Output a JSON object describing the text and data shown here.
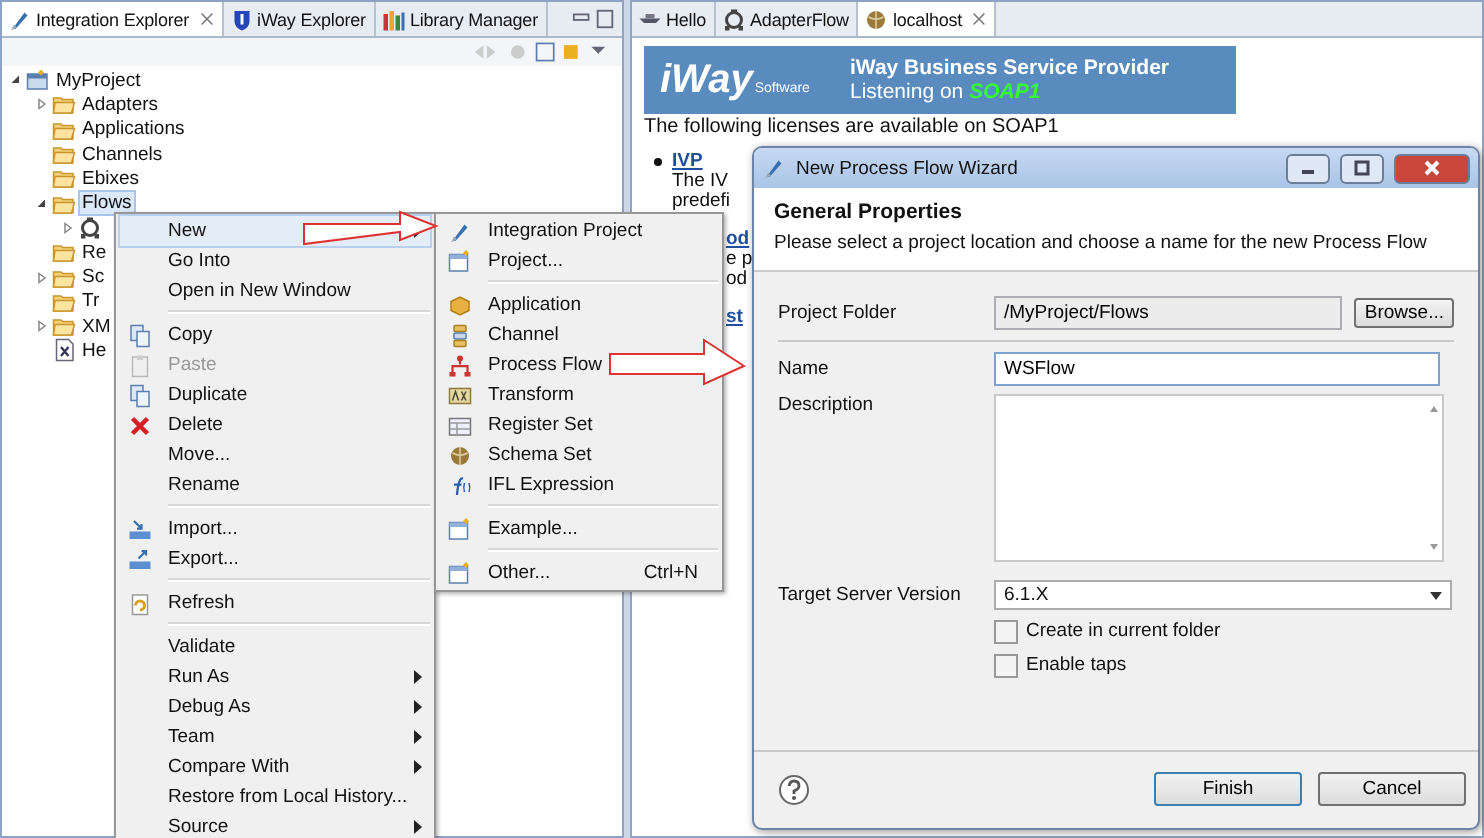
{
  "left_panel": {
    "tabs": [
      {
        "label": "Integration Explorer",
        "selected": true,
        "closable": true
      },
      {
        "label": "iWay Explorer",
        "selected": false,
        "closable": false
      },
      {
        "label": "Library Manager",
        "selected": false,
        "closable": false
      }
    ],
    "tree": [
      {
        "label": "MyProject",
        "kind": "project",
        "expanded": true,
        "selected": false,
        "children": [
          {
            "label": "Adapters",
            "kind": "folder",
            "expanded": false,
            "selected": false
          },
          {
            "label": "Applications",
            "kind": "folder",
            "selected": false
          },
          {
            "label": "Channels",
            "kind": "folder",
            "selected": false
          },
          {
            "label": "Ebixes",
            "kind": "folder",
            "selected": false
          },
          {
            "label": "Flows",
            "kind": "folder",
            "expanded": true,
            "selected": true,
            "children": [
              {
                "kind": "flow",
                "expanded": false
              }
            ]
          },
          {
            "label": "Re",
            "kind": "folder",
            "selected": false
          },
          {
            "label": "Sc",
            "kind": "folder",
            "expanded": false,
            "selected": false
          },
          {
            "label": "Tr",
            "kind": "folder",
            "selected": false
          },
          {
            "label": "XM",
            "kind": "folder",
            "expanded": false,
            "selected": false
          },
          {
            "label": "He",
            "kind": "file",
            "selected": false
          }
        ]
      }
    ]
  },
  "right_panel": {
    "tabs": [
      {
        "label": "Hello",
        "selected": false,
        "closable": false
      },
      {
        "label": "AdapterFlow",
        "selected": false,
        "closable": false
      },
      {
        "label": "localhost",
        "selected": true,
        "closable": true
      }
    ],
    "banner": {
      "logo_text": "iWay",
      "logo_subtext": "Software",
      "title": "iWay Business Service Provider",
      "listening_label": "Listening on",
      "listening_port": "SOAP1"
    },
    "intro": "The following licenses are available on SOAP1",
    "entries": [
      {
        "kind": "link",
        "text": "IVP",
        "bullet": true
      },
      {
        "kind": "text",
        "text": "The IV"
      },
      {
        "kind": "text",
        "text": "predefi"
      },
      {
        "kind": "fragment_link",
        "text": "od"
      },
      {
        "kind": "fragment",
        "text": "e p"
      },
      {
        "kind": "fragment",
        "text": "od"
      },
      {
        "kind": "fragment_link",
        "text": "st"
      }
    ]
  },
  "context_menu": {
    "groups": [
      [
        {
          "label": "New",
          "submenu": true,
          "selected": true,
          "disabled": false
        },
        {
          "label": "Go Into",
          "submenu": false,
          "selected": false,
          "disabled": false
        },
        {
          "label": "Open in New Window",
          "submenu": false,
          "selected": false,
          "disabled": false
        }
      ],
      [
        {
          "label": "Copy",
          "submenu": false,
          "selected": false,
          "disabled": false
        },
        {
          "label": "Paste",
          "submenu": false,
          "selected": false,
          "disabled": true
        },
        {
          "label": "Duplicate",
          "submenu": false,
          "selected": false,
          "disabled": false
        },
        {
          "label": "Delete",
          "submenu": false,
          "selected": false,
          "disabled": false
        },
        {
          "label": "Move...",
          "submenu": false,
          "selected": false,
          "disabled": false
        },
        {
          "label": "Rename",
          "submenu": false,
          "selected": false,
          "disabled": false
        }
      ],
      [
        {
          "label": "Import...",
          "submenu": false,
          "selected": false,
          "disabled": false
        },
        {
          "label": "Export...",
          "submenu": false,
          "selected": false,
          "disabled": false
        }
      ],
      [
        {
          "label": "Refresh",
          "submenu": false,
          "selected": false,
          "disabled": false
        }
      ],
      [
        {
          "label": "Validate",
          "submenu": false,
          "selected": false,
          "disabled": false
        },
        {
          "label": "Run As",
          "submenu": true,
          "selected": false,
          "disabled": false
        },
        {
          "label": "Debug As",
          "submenu": true,
          "selected": false,
          "disabled": false
        },
        {
          "label": "Team",
          "submenu": true,
          "selected": false,
          "disabled": false
        },
        {
          "label": "Compare With",
          "submenu": true,
          "selected": false,
          "disabled": false
        },
        {
          "label": "Restore from Local History...",
          "submenu": false,
          "selected": false,
          "disabled": false
        },
        {
          "label": "Source",
          "submenu": true,
          "selected": false,
          "disabled": false
        }
      ]
    ]
  },
  "submenu": {
    "groups": [
      [
        {
          "label": "Integration Project"
        },
        {
          "label": "Project..."
        }
      ],
      [
        {
          "label": "Application"
        },
        {
          "label": "Channel"
        },
        {
          "label": "Process Flow"
        },
        {
          "label": "Transform"
        },
        {
          "label": "Register Set"
        },
        {
          "label": "Schema Set"
        },
        {
          "label": "IFL Expression"
        }
      ],
      [
        {
          "label": "Example..."
        }
      ],
      [
        {
          "label": "Other...",
          "shortcut": "Ctrl+N"
        }
      ]
    ]
  },
  "dialog": {
    "title": "New Process Flow Wizard",
    "header": "General Properties",
    "description": "Please select a project location and choose a name for the new Process Flow",
    "project_folder": {
      "label": "Project Folder",
      "value": "/MyProject/Flows",
      "button": "Browse..."
    },
    "name": {
      "label": "Name",
      "value": "WSFlow"
    },
    "description_field": {
      "label": "Description"
    },
    "target_version": {
      "label": "Target Server Version",
      "value": "6.1.X"
    },
    "checkboxes": [
      {
        "label": "Create in current folder",
        "checked": false
      },
      {
        "label": "Enable taps",
        "checked": false
      }
    ],
    "buttons": [
      {
        "label": "Finish",
        "default": true
      },
      {
        "label": "Cancel",
        "default": false
      }
    ]
  }
}
